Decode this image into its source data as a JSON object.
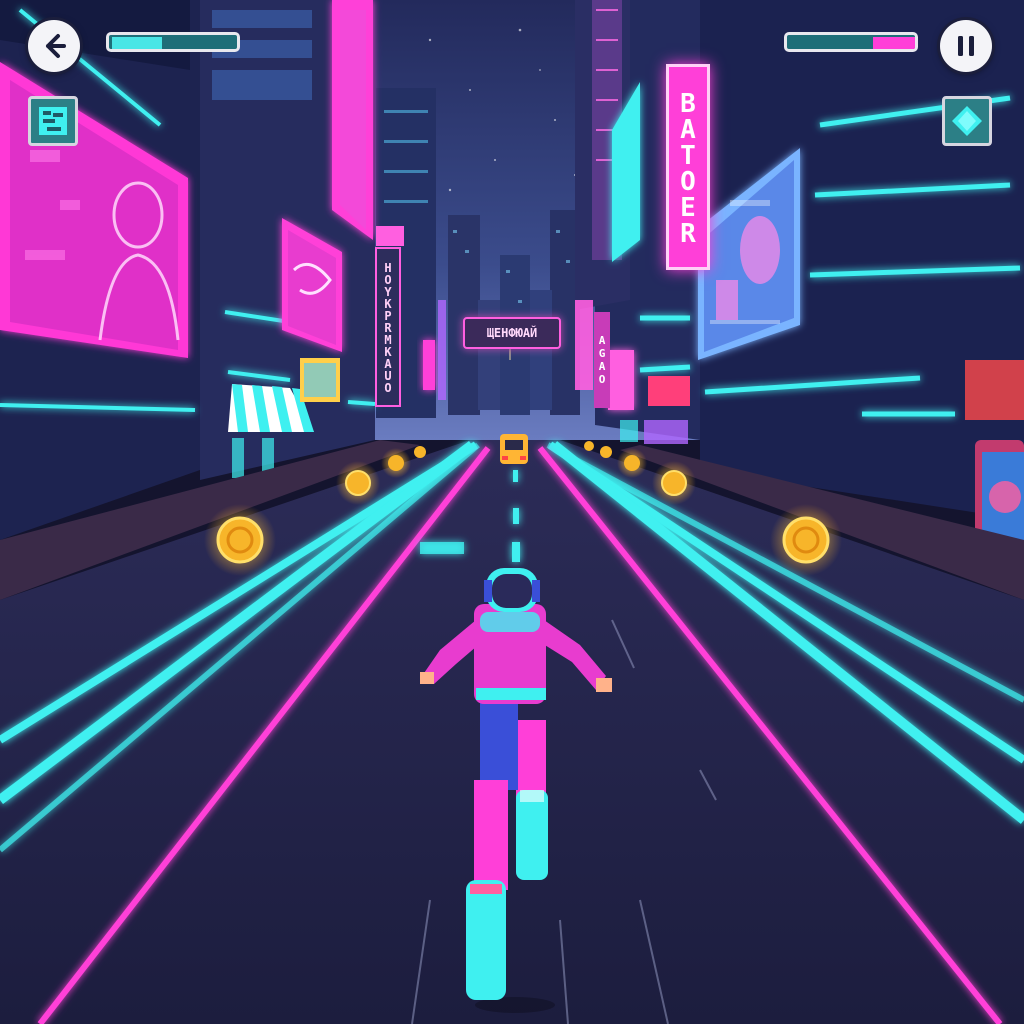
{
  "hud": {
    "back_button": {
      "icon": "arrow-left-icon"
    },
    "pause_button": {
      "icon": "pause-icon"
    },
    "left_meter": {
      "fill_fraction": 0.4,
      "color": "#49e6e6"
    },
    "right_meter": {
      "fill_fraction": 0.35,
      "color": "#ff3fd8"
    },
    "left_powerup": {
      "icon": "pixel-glyph-icon"
    },
    "right_powerup": {
      "icon": "diamond-gem-icon"
    }
  },
  "signs": {
    "vertical_sign_right": "BATOER",
    "overhead_sign": "ЩЕНФЮАЙ",
    "vertical_sign_left": "HOYKPRMKAUO",
    "small_sign_right": "AGAO"
  },
  "colors": {
    "neon_cyan": "#3ff0f0",
    "neon_magenta": "#ff3fd8",
    "road": "#22234a",
    "coin": "#f7b52a"
  }
}
